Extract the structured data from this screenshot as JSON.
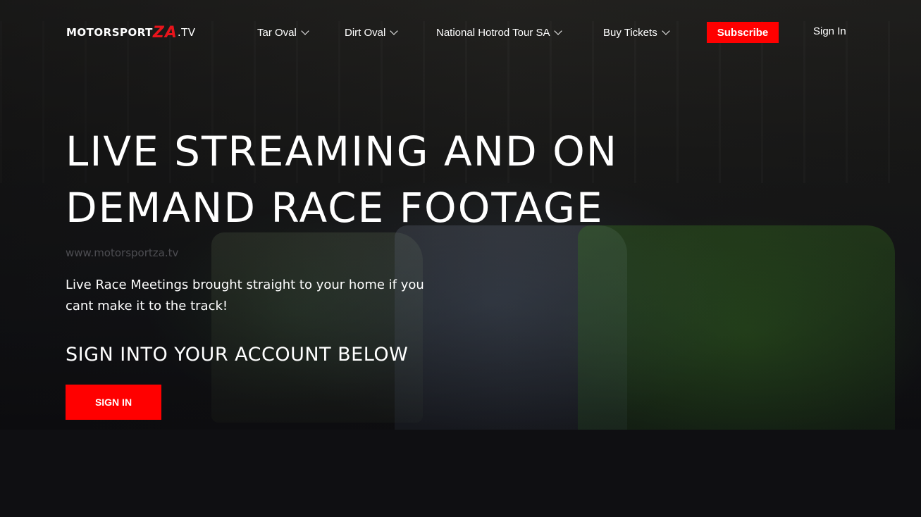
{
  "brand": {
    "logo_part1": "MOTORSPORT",
    "logo_part2": "ZA",
    "logo_part3": ".TV",
    "accent_color": "#ff0000"
  },
  "nav": {
    "items": [
      {
        "label": "Tar Oval",
        "icon": "chevron-down-icon"
      },
      {
        "label": "Dirt Oval",
        "icon": "chevron-down-icon"
      },
      {
        "label": "National Hotrod Tour SA",
        "icon": "chevron-down-icon"
      },
      {
        "label": "Buy Tickets",
        "icon": "chevron-down-icon"
      }
    ],
    "subscribe_label": "Subscribe",
    "signin_label": "Sign In"
  },
  "hero": {
    "headline_line1": "LIVE STREAMING AND ON",
    "headline_line2": "DEMAND RACE FOOTAGE",
    "site_url": "www.motorsportza.tv",
    "tagline": "Live Race Meetings brought straight to your home if you cant make it to the track!",
    "subhead": "SIGN INTO YOUR ACCOUNT BELOW",
    "cta_label": "SIGN IN"
  }
}
